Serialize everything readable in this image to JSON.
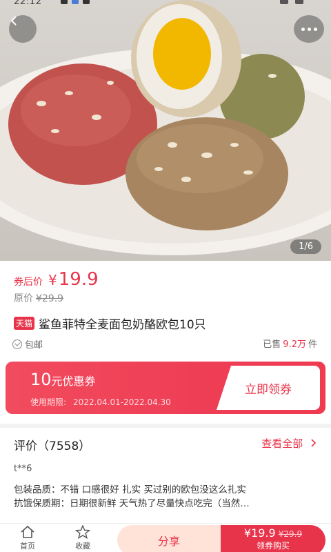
{
  "status_bar": {
    "time": "22:12"
  },
  "hero": {
    "page_indicator": "1/6"
  },
  "price": {
    "label": "券后价",
    "symbol": "¥",
    "value": "19.9",
    "original_label": "原价",
    "original_value": "¥29.9"
  },
  "product": {
    "badge": "天猫",
    "title": "鲨鱼菲特全麦面包奶酪欧包10只",
    "shipping": "包邮",
    "sold_prefix": "已售",
    "sold_count": "9.2万",
    "sold_suffix": "件"
  },
  "coupon": {
    "amount": "10",
    "amount_unit": "元优惠券",
    "validity_label": "使用期限:",
    "validity_dates": "2022.04.01-2022.04.30",
    "button": "立即领券"
  },
  "reviews": {
    "heading": "评价（7558）",
    "view_all": "查看全部",
    "reviewer": "t**6",
    "line1": "包装品质：不错 口感很好 扎实 买过别的欧包没这么扎实",
    "line2": "抗饿保质期：日期很新鲜 天气热了尽量快点吃完（当然…"
  },
  "bottom_bar": {
    "home": "首页",
    "favorite": "收藏",
    "share": "分享",
    "buy_price": "¥19.9",
    "buy_orig": "¥29.9",
    "buy_label": "领券购买"
  },
  "colors": {
    "accent": "#e8344a",
    "share_bg": "#ffe3d8"
  },
  "icons": {
    "back": "chevron-left-icon",
    "more": "more-dots-icon",
    "home": "home-icon",
    "favorite": "star-icon",
    "shipping": "check-circle-icon",
    "view_all": "chevron-right-icon"
  }
}
